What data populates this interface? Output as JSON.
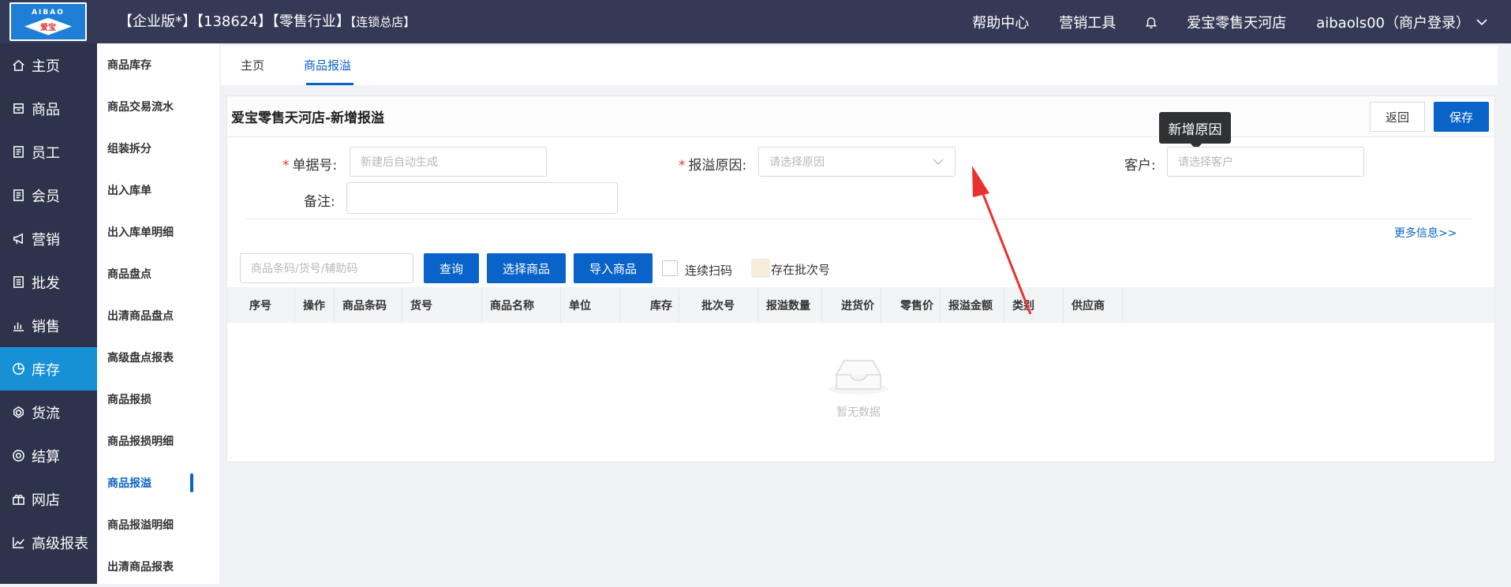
{
  "header": {
    "logo_text": "AIBAO",
    "logo_sub": "爱宝",
    "title_main": "【企业版*】【138624】【零售行业】",
    "title_small": "【连锁总店】",
    "nav": {
      "help": "帮助中心",
      "marketing_tool": "营销工具",
      "store": "爱宝零售天河店",
      "user": "aibaols00（商户登录）"
    }
  },
  "sidebar": {
    "items": [
      {
        "label": "主页",
        "icon": "home-icon"
      },
      {
        "label": "商品",
        "icon": "goods-icon"
      },
      {
        "label": "员工",
        "icon": "staff-icon"
      },
      {
        "label": "会员",
        "icon": "member-icon"
      },
      {
        "label": "营销",
        "icon": "megaphone-icon"
      },
      {
        "label": "批发",
        "icon": "wholesale-icon"
      },
      {
        "label": "销售",
        "icon": "chart-icon"
      },
      {
        "label": "库存",
        "icon": "pie-icon"
      },
      {
        "label": "货流",
        "icon": "flow-icon"
      },
      {
        "label": "结算",
        "icon": "settle-icon"
      },
      {
        "label": "网店",
        "icon": "shop-icon"
      },
      {
        "label": "高级报表",
        "icon": "line-chart-icon"
      }
    ],
    "active": "库存"
  },
  "subsidebar": {
    "items": [
      "商品库存",
      "商品交易流水",
      "组装拆分",
      "出入库单",
      "出入库单明细",
      "商品盘点",
      "出清商品盘点",
      "高级盘点报表",
      "商品报损",
      "商品报损明细",
      "商品报溢",
      "商品报溢明细",
      "出清商品报表"
    ],
    "active": "商品报溢"
  },
  "tabs": [
    {
      "label": "主页"
    },
    {
      "label": "商品报溢"
    }
  ],
  "form": {
    "title": "爱宝零售天河店-新增报溢",
    "back_label": "返回",
    "save_label": "保存",
    "order_no_label": "单据号:",
    "order_no_placeholder": "新建后自动生成",
    "reason_label": "报溢原因:",
    "reason_placeholder": "请选择原因",
    "customer_label": "客户:",
    "customer_placeholder": "请选择客户",
    "remark_label": "备注:",
    "tooltip": "新增原因",
    "more_info": "更多信息>>"
  },
  "toolbar": {
    "search_placeholder": "商品条码/货号/辅助码",
    "query_label": "查询",
    "select_label": "选择商品",
    "import_label": "导入商品",
    "continuous_scan": "连续扫码",
    "batch_legend": "存在批次号"
  },
  "table": {
    "columns": [
      "序号",
      "操作",
      "商品条码",
      "货号",
      "商品名称",
      "单位",
      "库存",
      "批次号",
      "报溢数量",
      "进货价",
      "零售价",
      "报溢金额",
      "类别",
      "供应商"
    ],
    "empty_text": "暂无数据"
  },
  "colors": {
    "topbar": "#343a55",
    "sidebar": "#2d334a",
    "active": "#1890d6",
    "primary": "#0a63c9",
    "arrow": "#e8322f"
  }
}
